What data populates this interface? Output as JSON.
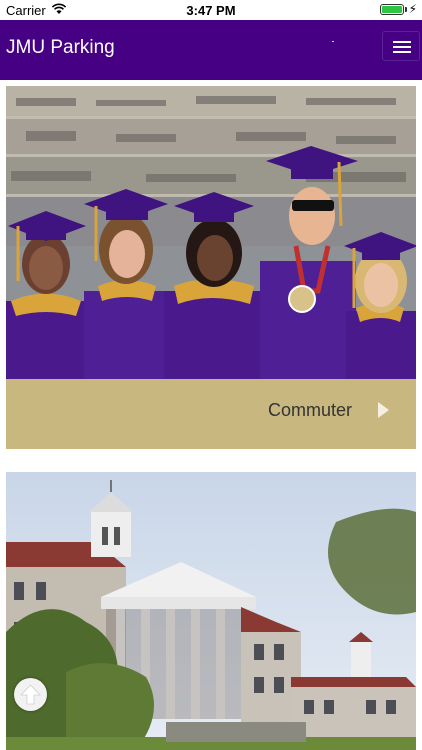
{
  "status_bar": {
    "carrier": "Carrier",
    "time": "3:47 PM",
    "battery_level": 1.0,
    "battery_color": "#2fc543"
  },
  "navbar": {
    "title": "JMU Parking",
    "background": "#450084",
    "menu_icon": "hamburger-menu-icon"
  },
  "cards": [
    {
      "label": "Commuter",
      "image": "graduates-photo",
      "arrow_icon": "chevron-right-icon"
    },
    {
      "label": "",
      "image": "campus-building-photo"
    }
  ],
  "scroll_top": {
    "icon": "arrow-up-icon"
  },
  "colors": {
    "card_footer": "#c8b880",
    "gown_purple": "#4a1a8c",
    "gold": "#d9a43a"
  }
}
